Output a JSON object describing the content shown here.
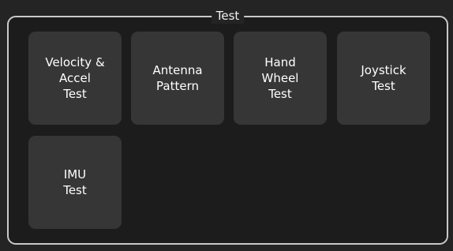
{
  "group": {
    "title": "Test"
  },
  "buttons": [
    {
      "label": "Velocity &\nAccel\nTest"
    },
    {
      "label": "Antenna\nPattern"
    },
    {
      "label": "Hand\nWheel\nTest"
    },
    {
      "label": "Joystick\nTest"
    },
    {
      "label": "IMU\nTest"
    }
  ]
}
